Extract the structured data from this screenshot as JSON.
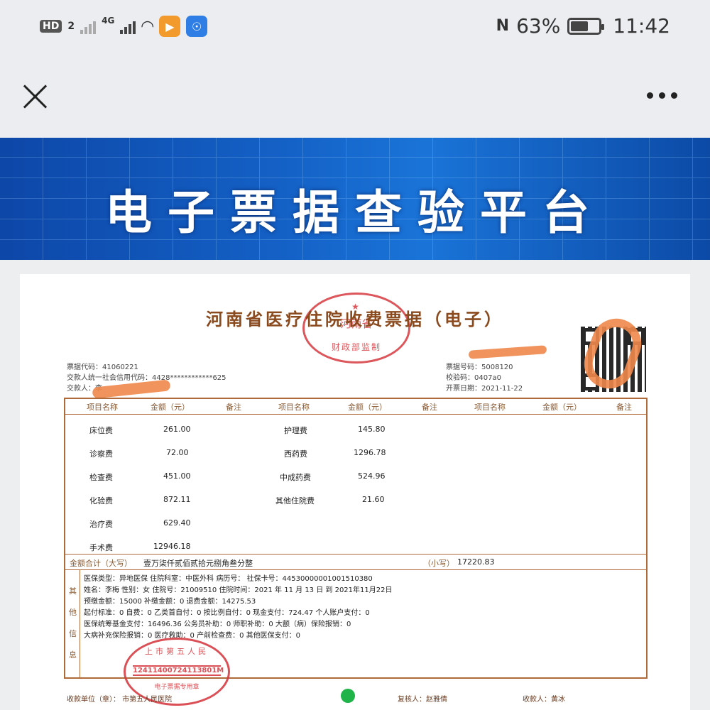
{
  "status": {
    "hd": "HD",
    "sim": "2",
    "net": "4G",
    "battery_text": "63%",
    "battery_level": 0.63,
    "time": "11:42",
    "nfc": "N"
  },
  "banner": {
    "title": "电子票据查验平台"
  },
  "receipt": {
    "title": "河南省医疗住院收费票据（电子）",
    "seal_top": {
      "line1": "河南省",
      "line2": "财政部监制"
    },
    "left_info": [
      "票据代码：41060221",
      "交款人统一社会信用代码：4428************625",
      "交款人：李"
    ],
    "right_info": [
      "票据号码：5008120",
      "校验码：0407a0",
      "开票日期：2021-11-22"
    ],
    "headers": [
      "项目名称",
      "金额（元）",
      "备注",
      "项目名称",
      "金额（元）",
      "备注",
      "项目名称",
      "金额（元）",
      "备注"
    ],
    "items_col1": [
      {
        "name": "床位费",
        "amount": "261.00"
      },
      {
        "name": "诊察费",
        "amount": "72.00"
      },
      {
        "name": "检查费",
        "amount": "451.00"
      },
      {
        "name": "化验费",
        "amount": "872.11"
      },
      {
        "name": "治疗费",
        "amount": "629.40"
      },
      {
        "name": "手术费",
        "amount": "12946.18"
      }
    ],
    "items_col2": [
      {
        "name": "护理费",
        "amount": "145.80"
      },
      {
        "name": "西药费",
        "amount": "1296.78"
      },
      {
        "name": "中成药费",
        "amount": "524.96"
      },
      {
        "name": "其他住院费",
        "amount": "21.60"
      }
    ],
    "total_upper_label": "金额合计（大写）",
    "total_upper": "壹万柒仟贰佰贰拾元捌角叁分整",
    "total_lower_label": "（小写）",
    "total_lower": "17220.83",
    "other_label": [
      "其",
      "他",
      "信",
      "息"
    ],
    "other_lines": [
      "医保类型：异地医保    住院科室：中医外科          病历号：                    社保卡号：44530000001001510380",
      "姓名：李梅          性别：女              住院号：21009510                        住院时间：2021 年 11 月 13 日 到 2021年11月22日",
      "预缴金额：15000                        补缴金额：0                                      退费金额：14275.53",
      "起付标准：0           自费：0              乙类首自付：0           按比例自付：0           现金支付：724.47      个人账户支付：0",
      "医保统筹基金支付：16496.36          公务员补助：0             师职补助：0            大额（病）保险报销：0",
      "大病补充保险报销：0                医疗救助：0             产前检查费：0           其他医保支付：0"
    ],
    "seal_bottom": {
      "line1": "上市第五人民",
      "line2": "12411400724113801M",
      "line3": "电子票据专用章"
    },
    "footer": {
      "payee_unit": "收款单位（章）：     市第五人民医院",
      "reviewer": "复核人：赵雅倩",
      "payee": "收款人：黄冰"
    }
  }
}
